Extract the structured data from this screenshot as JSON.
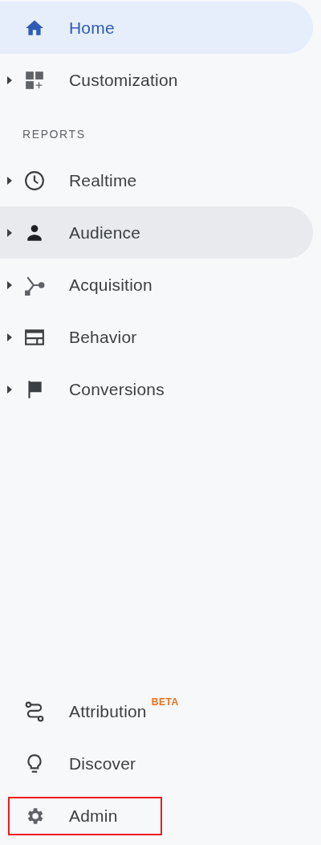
{
  "top_items": [
    {
      "label": "Home",
      "expandable": false,
      "selected": true,
      "hovered": false
    },
    {
      "label": "Customization",
      "expandable": true,
      "selected": false,
      "hovered": false
    }
  ],
  "reports": {
    "title": "REPORTS",
    "items": [
      {
        "label": "Realtime",
        "expandable": true,
        "selected": false,
        "hovered": false
      },
      {
        "label": "Audience",
        "expandable": true,
        "selected": false,
        "hovered": true
      },
      {
        "label": "Acquisition",
        "expandable": true,
        "selected": false,
        "hovered": false
      },
      {
        "label": "Behavior",
        "expandable": true,
        "selected": false,
        "hovered": false
      },
      {
        "label": "Conversions",
        "expandable": true,
        "selected": false,
        "hovered": false
      }
    ]
  },
  "bottom_items": [
    {
      "label": "Attribution",
      "badge": "BETA",
      "expandable": false,
      "selected": false,
      "hovered": false,
      "outlined": false
    },
    {
      "label": "Discover",
      "expandable": false,
      "selected": false,
      "hovered": false,
      "outlined": false
    },
    {
      "label": "Admin",
      "expandable": false,
      "selected": false,
      "hovered": false,
      "outlined": true
    }
  ]
}
